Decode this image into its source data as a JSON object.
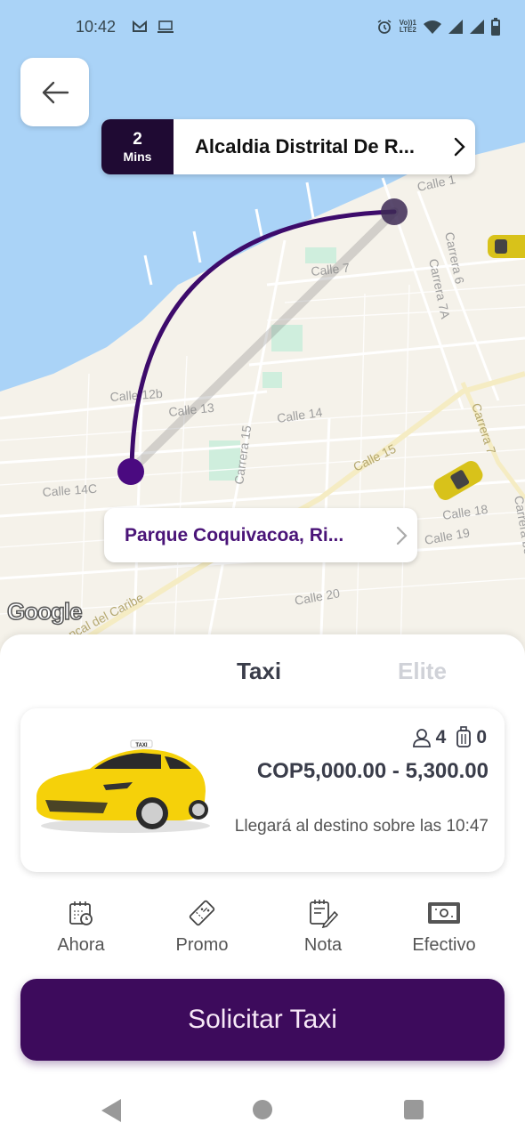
{
  "status_bar": {
    "time": "10:42",
    "left_icons": [
      "gmail-icon",
      "laptop-icon"
    ],
    "right_icons": [
      "alarm-icon",
      "volte-icon",
      "wifi-icon",
      "signal-icon",
      "signal-icon",
      "battery-icon"
    ],
    "volte_line1": "Vo))1",
    "volte_line2": "LTE2"
  },
  "map": {
    "streets": [
      "Calle 1",
      "Calle 7",
      "Carrera 6",
      "Carrera 7A",
      "Calle 12b",
      "Calle 13",
      "Calle 14",
      "Carrera 15",
      "Calle 14C",
      "Calle 15",
      "Carrera 7",
      "Calle 18",
      "Calle 19",
      "Calle 20",
      "Troncal del Caribe"
    ],
    "provider": "Google"
  },
  "pickup": {
    "eta_value": "2",
    "eta_unit": "Mins",
    "address": "Alcaldia Distrital De R..."
  },
  "destination": {
    "address": "Parque Coquivacoa, Ri..."
  },
  "service_tabs": [
    {
      "label": "Taxi",
      "active": true
    },
    {
      "label": "Elite",
      "active": false
    }
  ],
  "vehicle_card": {
    "image_label": "TAXI",
    "passengers": "4",
    "luggage": "0",
    "price": "COP5,000.00 - 5,300.00",
    "arrival": "Llegará al destino sobre las 10:47"
  },
  "options": [
    {
      "icon": "calendar-clock-icon",
      "label": "Ahora"
    },
    {
      "icon": "coupon-icon",
      "label": "Promo"
    },
    {
      "icon": "note-pencil-icon",
      "label": "Nota"
    },
    {
      "icon": "cash-icon",
      "label": "Efectivo"
    }
  ],
  "cta": {
    "label": "Solicitar Taxi"
  },
  "colors": {
    "brand_purple": "#3d0b5c",
    "eta_bg": "#1f0a33",
    "route": "#3d0b6b",
    "destination_text": "#4a1478",
    "water": "#aad3f7",
    "land": "#f5f2ea"
  }
}
